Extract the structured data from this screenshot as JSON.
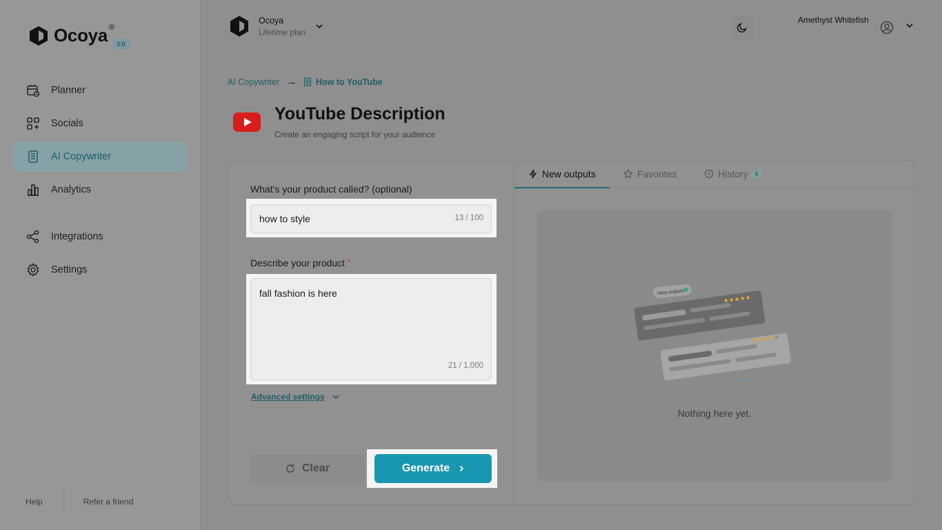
{
  "brand": {
    "name": "Ocoya",
    "registered": "®",
    "version": "3.0"
  },
  "sidebar": {
    "items": [
      {
        "label": "Planner",
        "icon": "calendar-icon"
      },
      {
        "label": "Socials",
        "icon": "apps-plus-icon"
      },
      {
        "label": "AI Copywriter",
        "icon": "document-icon",
        "active": true
      },
      {
        "label": "Analytics",
        "icon": "bar-chart-icon"
      },
      {
        "label": "Integrations",
        "icon": "share-nodes-icon"
      },
      {
        "label": "Settings",
        "icon": "gear-icon"
      }
    ],
    "footer": {
      "help": "Help",
      "refer": "Refer a friend"
    }
  },
  "workspace": {
    "name": "Ocoya",
    "plan": "Lifetime plan"
  },
  "user": {
    "name": "Amethyst Whitefish"
  },
  "breadcrumb": {
    "parent": "AI Copywriter",
    "arrow": "→",
    "current": "How to YouTube"
  },
  "page": {
    "title": "YouTube Description",
    "subtitle": "Create an engaging script for your audience"
  },
  "form": {
    "product_name": {
      "label": "What's your product called? (optional)",
      "value": "how to style",
      "counter": "13 / 100"
    },
    "description": {
      "label": "Describe your product",
      "required_mark": "*",
      "value": "fall fashion is here",
      "counter": "21 / 1,000"
    },
    "advanced_label": "Advanced settings",
    "clear_label": "Clear",
    "generate_label": "Generate"
  },
  "tabs": [
    {
      "label": "New outputs",
      "icon": "bolt-icon",
      "active": true
    },
    {
      "label": "Favorites",
      "icon": "star-icon"
    },
    {
      "label": "History",
      "icon": "clock-icon",
      "badge": "5"
    }
  ],
  "output": {
    "empty_text": "Nothing here yet.",
    "illustration_label": "New outputs"
  },
  "colors": {
    "accent": "#1997b0",
    "brand_teal": "#1f5d68",
    "youtube_red": "#d91c1c"
  }
}
